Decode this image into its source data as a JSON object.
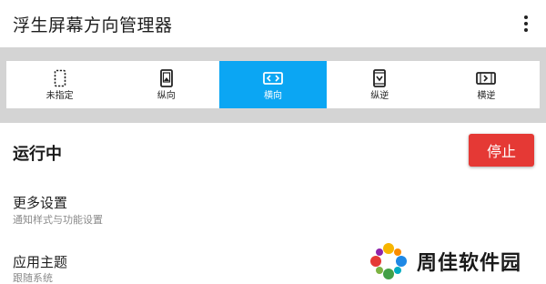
{
  "app_bar": {
    "title": "浮生屏幕方向管理器",
    "overflow_icon": "more-vert-icon"
  },
  "mode_bar": {
    "active_color": "#0ba6f3",
    "items": [
      {
        "label": "未指定",
        "icon": "unspecified-phone-icon",
        "active": false
      },
      {
        "label": "纵向",
        "icon": "portrait-phone-icon",
        "active": false
      },
      {
        "label": "横向",
        "icon": "landscape-phone-icon",
        "active": true
      },
      {
        "label": "纵逆",
        "icon": "reverse-portrait-phone-icon",
        "active": false
      },
      {
        "label": "横逆",
        "icon": "reverse-landscape-phone-icon",
        "active": false
      }
    ]
  },
  "status": {
    "label": "运行中",
    "stop_label": "停止",
    "stop_color": "#e53935"
  },
  "settings": [
    {
      "title": "更多设置",
      "subtitle": "通知样式与功能设置"
    },
    {
      "title": "应用主题",
      "subtitle": "跟随系统"
    }
  ],
  "watermark": {
    "text": "周佳软件园"
  }
}
